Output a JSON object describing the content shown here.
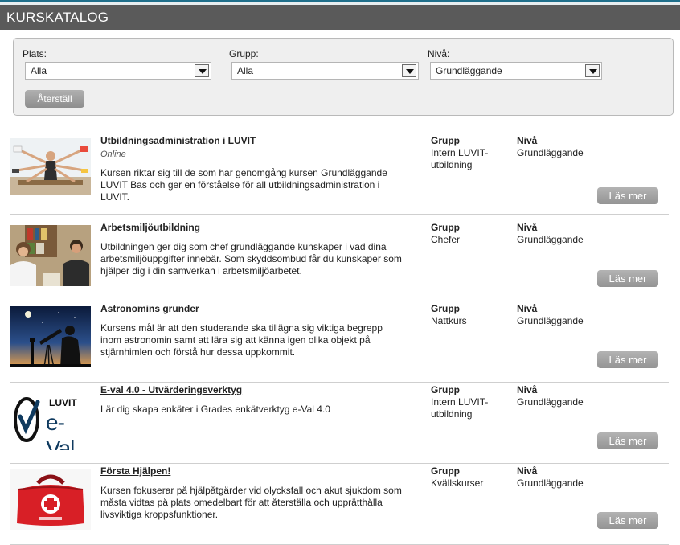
{
  "header": {
    "title": "KURSKATALOG"
  },
  "filters": {
    "plats": {
      "label": "Plats:",
      "value": "Alla"
    },
    "grupp": {
      "label": "Grupp:",
      "value": "Alla"
    },
    "niva": {
      "label": "Nivå:",
      "value": "Grundläggande"
    },
    "reset_label": "Återställ"
  },
  "labels": {
    "grupp": "Grupp",
    "niva": "Nivå",
    "more": "Läs mer"
  },
  "courses": [
    {
      "title": "Utbildningsadministration i LUVIT",
      "mode": "Online",
      "description": "Kursen riktar sig till de som har genomgång kursen Grundläggande LUVIT Bas och ger en förståelse för all utbildningsadministration i LUVIT.",
      "grupp": "Intern LUVIT-utbildning",
      "niva": "Grundläggande",
      "image_icon": "multitasking-woman-photo"
    },
    {
      "title": "Arbetsmiljöutbildning",
      "description": "Utbildningen ger dig som chef grundläggande kunskaper i vad dina arbetsmiljöuppgifter innebär. Som skyddsombud får du kunskaper som hjälper dig i din samverkan i arbetsmiljöarbetet.",
      "grupp": "Chefer",
      "niva": "Grundläggande",
      "image_icon": "office-meeting-photo"
    },
    {
      "title": "Astronomins grunder",
      "description": "Kursens mål är att den studerande ska tillägna sig viktiga begrepp inom astronomin samt att lära sig att känna igen olika objekt på stjärnhimlen och förstå hur dessa uppkommit.",
      "grupp": "Nattkurs",
      "niva": "Grundläggande",
      "image_icon": "telescope-night-photo"
    },
    {
      "title": "E-val 4.0 - Utvärderingsverktyg",
      "description": "Lär dig skapa enkäter i Grades enkätverktyg e-Val 4.0",
      "grupp": "Intern LUVIT-utbildning",
      "niva": "Grundläggande",
      "image_icon": "luvit-eval-logo",
      "logo_brand": "LUVIT",
      "logo_product": "e-Val"
    },
    {
      "title": "Första Hjälpen!",
      "description": "Kursen fokuserar på hjälpåtgärder vid olycksfall och akut sjukdom som måsta vidtas på plats omedelbart för att återställa och upprätthålla livsviktiga kroppsfunktioner.",
      "grupp": "Kvällskurser",
      "niva": "Grundläggande",
      "image_icon": "first-aid-bag-photo"
    }
  ],
  "colors": {
    "header_bg": "#5a5a5a",
    "accent_line": "#1f6f8b",
    "button_gray": "#9e9e9e",
    "first_aid_red": "#d81f26"
  }
}
